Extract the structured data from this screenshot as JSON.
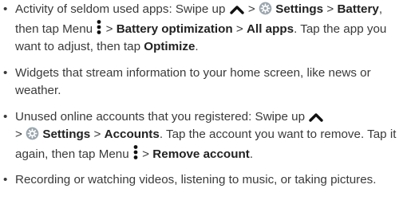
{
  "items": [
    {
      "lead": "Activity of seldom used apps: Swipe up",
      "gt1": ">",
      "settings": "Settings",
      "gt2": ">",
      "battery": "Battery",
      "after_battery": ", then tap Menu",
      "gt3": ">",
      "battery_optimization": "Battery optimization",
      "gt4": ">",
      "all_apps": "All apps",
      "tail": ". Tap the app you want to adjust, then tap",
      "optimize": "Optimize",
      "end": "."
    },
    {
      "text": "Widgets that stream information to your home screen, like news or weather."
    },
    {
      "lead": "Unused online accounts that you registered: Swipe up",
      "gt1": ">",
      "settings": "Settings",
      "gt2": ">",
      "accounts": "Accounts",
      "tail": ". Tap the account you want to remove. Tap it again, then tap Menu",
      "gt3": ">",
      "remove_account": "Remove account",
      "end": "."
    },
    {
      "text": "Recording or watching videos, listening to music, or taking pictures."
    }
  ],
  "bullet_char": "•",
  "icons": {
    "swipe_up": "chevron-up-icon",
    "settings": "settings-gear-icon",
    "menu": "vertical-dots-menu-icon"
  },
  "colors": {
    "text": "#3a3a3a",
    "bold": "#222222",
    "gear_ring": "#9aa5ad",
    "gear_center": "#ffffff"
  }
}
